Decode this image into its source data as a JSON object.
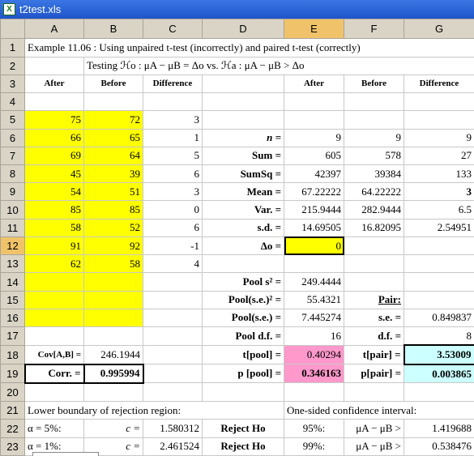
{
  "window": {
    "title": "t2test.xls",
    "icon": "excel-icon"
  },
  "columns": [
    "A",
    "B",
    "C",
    "D",
    "E",
    "F",
    "G"
  ],
  "selected_column": "E",
  "selected_row": "12",
  "rows": {
    "r1": {
      "num": "1",
      "A": "Example 11.06 :  Using unpaired t-test (incorrectly) and paired t-test (correctly)"
    },
    "r2": {
      "num": "2",
      "B": "Testing  ℋo : μA − μB = Δo   vs.  ℋa : μA − μB > Δo"
    },
    "r3": {
      "num": "3",
      "A": "After",
      "B": "Before",
      "C": "Difference",
      "E": "After",
      "F": "Before",
      "G": "Difference"
    },
    "r4": {
      "num": "4"
    },
    "r5": {
      "num": "5",
      "A": "75",
      "B": "72",
      "C": "3"
    },
    "r6": {
      "num": "6",
      "A": "66",
      "B": "65",
      "C": "1",
      "D": "n =",
      "E": "9",
      "F": "9",
      "G": "9"
    },
    "r7": {
      "num": "7",
      "A": "69",
      "B": "64",
      "C": "5",
      "D": "Sum =",
      "E": "605",
      "F": "578",
      "G": "27"
    },
    "r8": {
      "num": "8",
      "A": "45",
      "B": "39",
      "C": "6",
      "D": "SumSq =",
      "E": "42397",
      "F": "39384",
      "G": "133"
    },
    "r9": {
      "num": "9",
      "A": "54",
      "B": "51",
      "C": "3",
      "D": "Mean =",
      "E": "67.22222",
      "F": "64.22222",
      "G": "3"
    },
    "r10": {
      "num": "10",
      "A": "85",
      "B": "85",
      "C": "0",
      "D": "Var. =",
      "E": "215.9444",
      "F": "282.9444",
      "G": "6.5"
    },
    "r11": {
      "num": "11",
      "A": "58",
      "B": "52",
      "C": "6",
      "D": "s.d. =",
      "E": "14.69505",
      "F": "16.82095",
      "G": "2.54951"
    },
    "r12": {
      "num": "12",
      "A": "91",
      "B": "92",
      "C": "-1",
      "D": "Δo =",
      "E": "0"
    },
    "r13": {
      "num": "13",
      "A": "62",
      "B": "58",
      "C": "4"
    },
    "r14": {
      "num": "14",
      "D": "Pool s² =",
      "E": "249.4444"
    },
    "r15": {
      "num": "15",
      "D": "Pool(s.e.)² =",
      "E": "55.4321",
      "F": "Pair:"
    },
    "r16": {
      "num": "16",
      "D": "Pool(s.e.) =",
      "E": "7.445274",
      "F": "s.e. =",
      "G": "0.849837"
    },
    "r17": {
      "num": "17",
      "D": "Pool d.f. =",
      "E": "16",
      "F": "d.f. =",
      "G": "8"
    },
    "r18": {
      "num": "18",
      "A": "Cov[A,B] =",
      "B": "246.1944",
      "D": "t[pool] =",
      "E": "0.40294",
      "F": "t[pair] =",
      "G": "3.53009"
    },
    "r19": {
      "num": "19",
      "A": "Corr. =",
      "B": "0.995994",
      "D": "p [pool] =",
      "E": "0.346163",
      "F": "p[pair] =",
      "G": "0.003865"
    },
    "r20": {
      "num": "20"
    },
    "r21": {
      "num": "21",
      "A": "Lower boundary of rejection region:",
      "E": "One-sided confidence interval:"
    },
    "r22": {
      "num": "22",
      "A": "α = 5%:",
      "B": "c =",
      "C": "1.580312",
      "D": "Reject Ho",
      "E": "95%:",
      "F": "μA − μB >",
      "G": "1.419688"
    },
    "r23": {
      "num": "23",
      "A": "α = 1%:",
      "B": "c =",
      "C": "2.461524",
      "D": "Reject Ho",
      "E": "99%:",
      "F": "μA − μB >",
      "G": "0.538476"
    }
  }
}
